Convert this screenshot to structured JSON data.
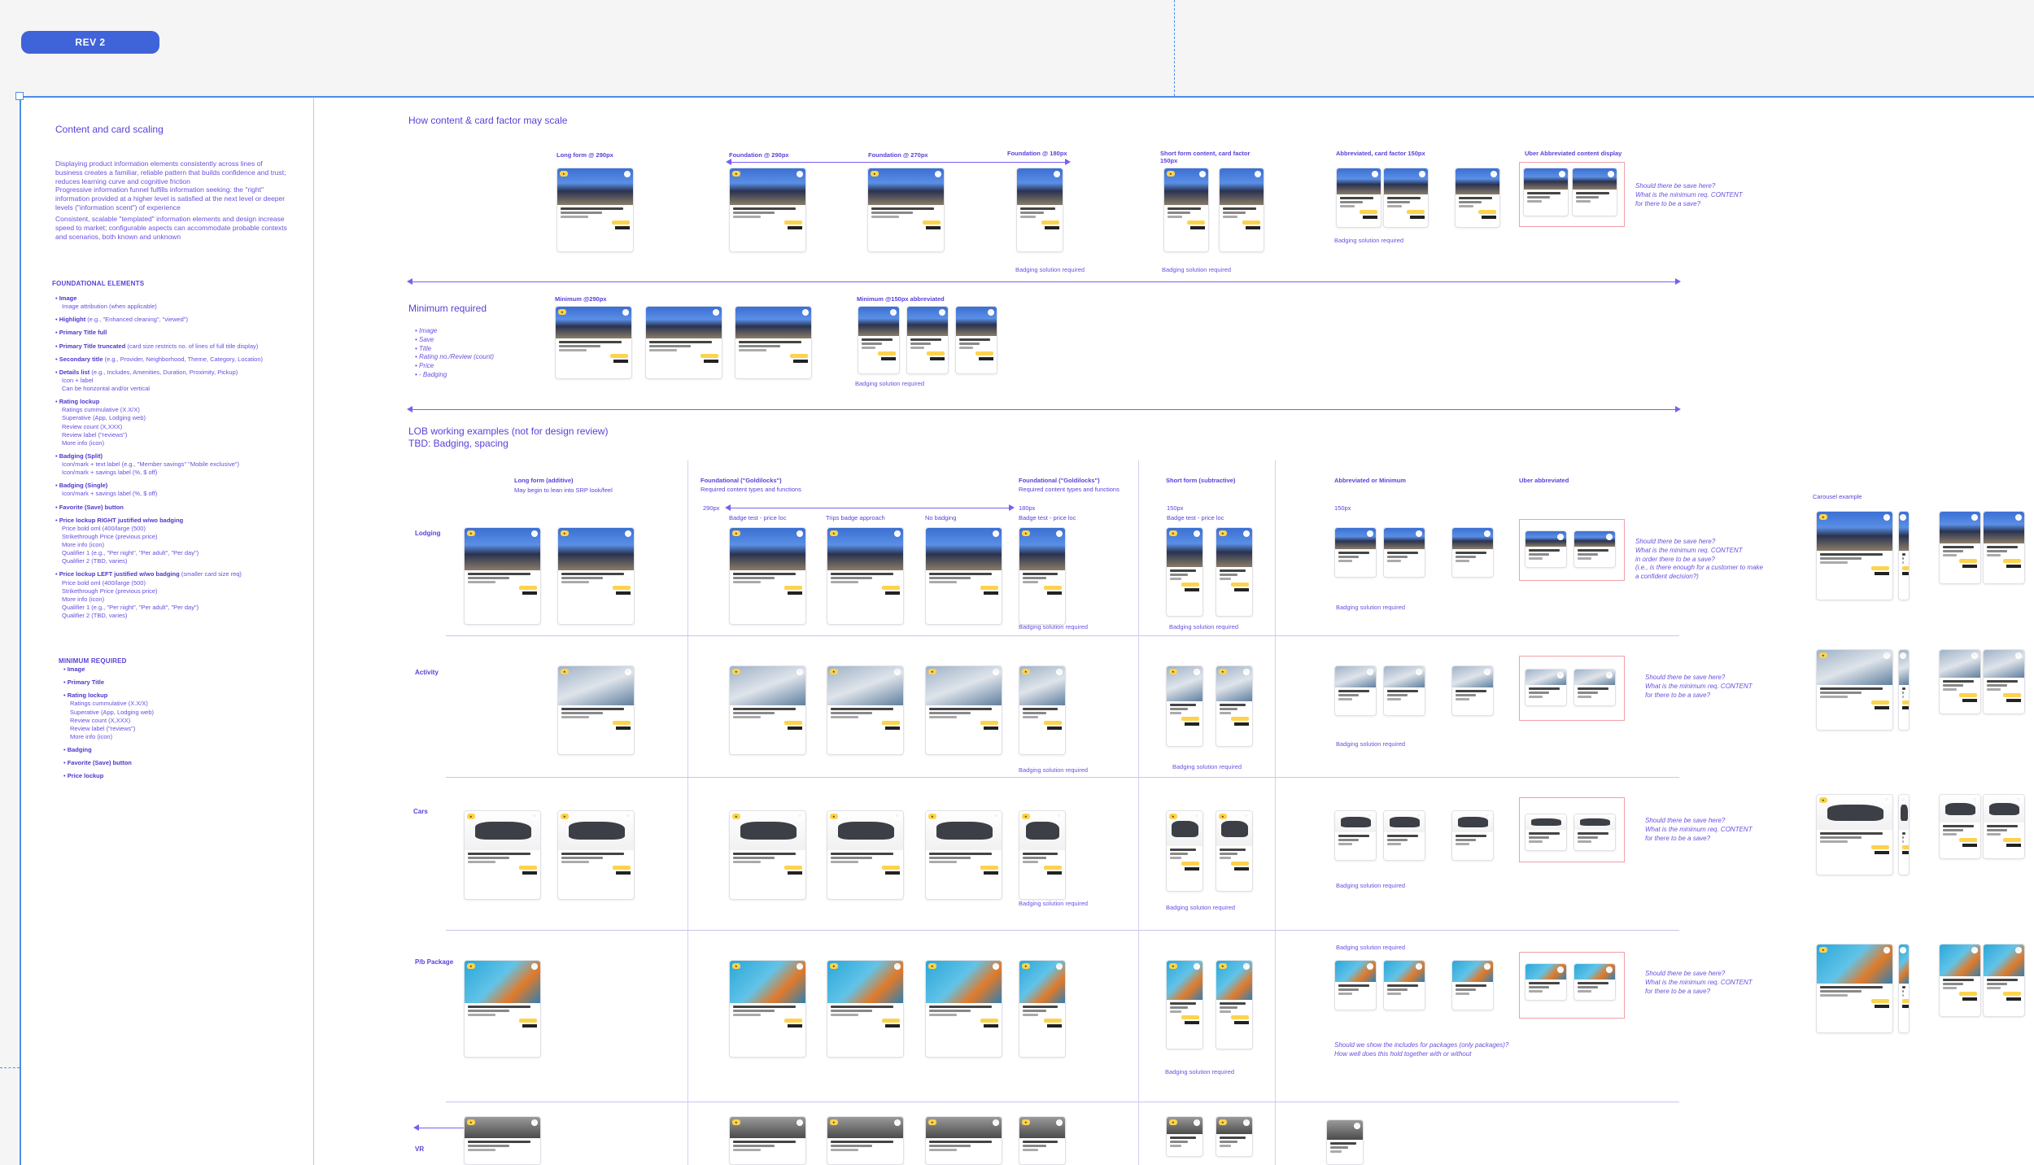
{
  "rev_label": "REV 2",
  "left": {
    "title": "Content and card scaling",
    "para1": "Displaying product information elements consistently across lines of business creates a familiar, reliable pattern that builds confidence and trust; reduces learning curve and cognitive friction",
    "para2": "Progressive information funnel fulfills information seeking: the \"right\" information provided at a higher level is satisfied at the next level or deeper levels (\"information scent\") of experience",
    "para3": "Consistent, scalable \"templated\" information elements and design increase speed to market; configurable aspects can accommodate probable contexts and scenarios, both known and unknown",
    "foundational_heading": "FOUNDATIONAL ELEMENTS",
    "foundational": [
      {
        "label": "Image",
        "sub": [
          "Image attribution (when applicable)"
        ]
      },
      {
        "label": "Highlight",
        "suffix": " (e.g., \"Enhanced cleaning\", \"viewed\")",
        "sub": []
      },
      {
        "label": "Primary Title full",
        "sub": []
      },
      {
        "label": "Primary Title truncated",
        "suffix": " (card size restricts no. of lines of full title display)",
        "sub": []
      },
      {
        "label": "Secondary title",
        "suffix": " (e.g., Provider, Neighborhood, Theme, Category, Location)",
        "sub": []
      },
      {
        "label": "Details list",
        "suffix": " (e.g., Includes, Amenities, Duration, Proximity, Pickup)",
        "sub": [
          "Icon + label",
          "Can be horizontal and/or vertical"
        ]
      },
      {
        "label": "Rating lockup",
        "sub": [
          "Ratings cummulative (X.X/X)",
          "Superative (App, Lodging web)",
          "Review count (X,XXX)",
          "Review label (\"reviews\")",
          "More info (icon)"
        ]
      },
      {
        "label": "Badging (Split)",
        "sub": [
          "Icon/mark + text label (e.g., \"Member savings\" \"Mobile exclusive\")",
          "Icon/mark + savings label (%, $ off)"
        ]
      },
      {
        "label": "Badging (Single)",
        "sub": [
          "Icon/mark + savings label (%, $ off)"
        ]
      },
      {
        "label": "Favorite (Save) button",
        "sub": []
      },
      {
        "label": "Price lockup RIGHT justified w/wo badging",
        "sub": [
          "Price bold oml (400/large (500)",
          "Strikethrough Price (previous price)",
          "More info (icon)",
          "Qualifier 1 (e.g., \"Per night\", \"Per adult\", \"Per day\")",
          "Qualifier 2 (TBD, varies)"
        ]
      },
      {
        "label": "Price lockup LEFT justified w/wo badging",
        "suffix": " (smaller card size req)",
        "sub": [
          "Price bold oml (400/large (500)",
          "Strikethrough Price (previous price)",
          "More info (icon)",
          "Qualifier 1 (e.g., \"Per night\", \"Per adult\", \"Per day\")",
          "Qualifier 2 (TBD, varies)"
        ]
      }
    ],
    "minimum_heading": "MINIMUM REQUIRED",
    "minimum": [
      {
        "label": "Image",
        "sub": []
      },
      {
        "label": "Primary Title",
        "sub": []
      },
      {
        "label": "Rating lockup",
        "sub": [
          "Ratings cummulative (X.X/X)",
          "Superative (App, Lodging web)",
          "Review count (X,XXX)",
          "Review label (\"reviews\")",
          "More info (icon)"
        ]
      },
      {
        "label": "Badging",
        "sub": []
      },
      {
        "label": "Favorite (Save) button",
        "sub": []
      },
      {
        "label": "Price lockup",
        "sub": []
      }
    ]
  },
  "section1": {
    "title": "How content & card factor may scale",
    "labels": {
      "long_form": "Long form @ 290px",
      "foundation_290": "Foundation @ 290px",
      "foundation_270": "Foundation @ 270px",
      "foundation_180": "Foundation @ 180px",
      "short_form": "Short form content, card factor 150px",
      "abbreviated": "Abbreviated, card factor 150px",
      "uber": "Uber Abbreviated content display"
    },
    "badging_required": "Badging solution required",
    "save_question": "Should there be save here?\nWhat is the minimum req. CONTENT\nfor there to be a save?"
  },
  "section2": {
    "title": "Minimum required",
    "min_290": "Minimum @290px",
    "min_150": "Minimum @150px abbreviated",
    "items": [
      "Image",
      "Save",
      "Title",
      "Rating no./Review (count)",
      "Price",
      "- Badging"
    ],
    "badging_required": "Badging solution required"
  },
  "section3": {
    "title_line1": "LOB working examples (not for design review)",
    "title_line2": "TBD: Badging, spacing",
    "columns": {
      "long_form": "Long form (additive)",
      "long_form_sub": "May begin to lean into SRP look/feel",
      "foundational_a": "Foundational (\"Goldilocks\")",
      "foundational_a_sub": "Required content types and functions",
      "foundational_b": "Foundational (\"Goldilocks\")",
      "foundational_b_sub": "Required content types and functions",
      "short_form": "Short form (subtractive)",
      "abbreviated": "Abbreviated or Minimum",
      "uber": "Uber abbreviated",
      "carousel": "Carousel example"
    },
    "subs": {
      "w290": "290px",
      "badge_test": "Badge test - price loc",
      "trips_badge": "Trips badge approach",
      "no_badging": "No badging",
      "w180": "180px",
      "badge_test_b": "Badge test - price loc",
      "w150": "150px",
      "badge_test_c": "Badge test - price loc",
      "w150b": "150px"
    },
    "rows": [
      "Lodging",
      "Activity",
      "Cars",
      "P/b Package",
      "VR"
    ],
    "badging_required": "Badging solution required",
    "q_lodging": "Should there be save here?\nWhat is the minimum req. CONTENT\nin order there to be a save?\n(i.e., is there enough for a customer to make\na confident decision?)",
    "q_generic": "Should there be save here?\nWhat is the minimum req. CONTENT\nfor there to be a save?",
    "pkg_note": "Should we show the includes for packages (only packages)?\nHow well does this hold together with or without"
  }
}
